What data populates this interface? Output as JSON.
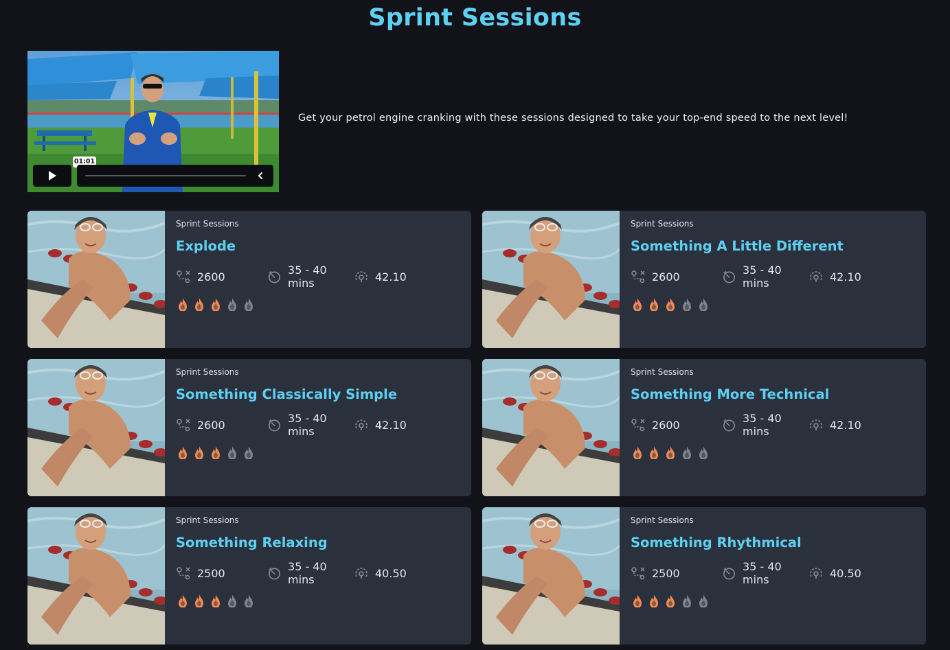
{
  "page": {
    "title": "Sprint Sessions",
    "intro": "Get your petrol engine cranking with these sessions designed to take your top-end speed to the next level!"
  },
  "video": {
    "timestamp": "01:01",
    "play_icon": "play-icon",
    "collapse_icon": "chevron-left-icon"
  },
  "colors": {
    "accent": "#5ed0f2",
    "flame_active": "#f28a55",
    "flame_inactive": "#7f848c",
    "card_bg": "#2a313d",
    "page_bg": "#111318"
  },
  "intensity_max": 5,
  "cards": [
    {
      "category": "Sprint Sessions",
      "title": "Explode",
      "distance": "2600",
      "duration": "35 - 40 mins",
      "pace": "42.10",
      "intensity": 3
    },
    {
      "category": "Sprint Sessions",
      "title": "Something A Little Different",
      "distance": "2600",
      "duration": "35 - 40 mins",
      "pace": "42.10",
      "intensity": 3
    },
    {
      "category": "Sprint Sessions",
      "title": "Something Classically Simple",
      "distance": "2600",
      "duration": "35 - 40 mins",
      "pace": "42.10",
      "intensity": 3
    },
    {
      "category": "Sprint Sessions",
      "title": "Something More Technical",
      "distance": "2600",
      "duration": "35 - 40 mins",
      "pace": "42.10",
      "intensity": 3
    },
    {
      "category": "Sprint Sessions",
      "title": "Something Relaxing",
      "distance": "2500",
      "duration": "35 - 40 mins",
      "pace": "40.50",
      "intensity": 3
    },
    {
      "category": "Sprint Sessions",
      "title": "Something Rhythmical",
      "distance": "2500",
      "duration": "35 - 40 mins",
      "pace": "40.50",
      "intensity": 3
    }
  ]
}
